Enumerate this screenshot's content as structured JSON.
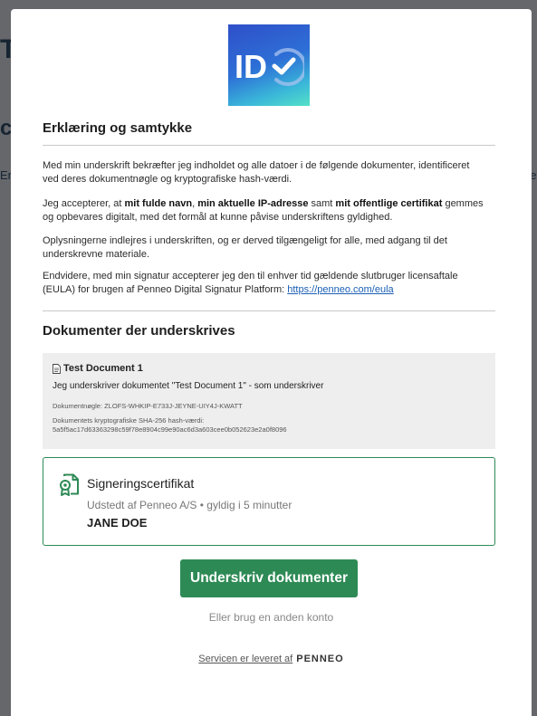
{
  "background": {
    "fragments": [
      "T",
      "c",
      "Er",
      "ne"
    ]
  },
  "modal": {
    "logo_label": "ID",
    "consent": {
      "title": "Erklæring og samtykke",
      "p1": "Med min underskrift bekræfter jeg indholdet og alle datoer i de følgende dokumenter, identificeret ved deres dokumentnøgle og kryptografiske hash-værdi.",
      "p2_a": "Jeg accepterer, at ",
      "p2_b1": "mit fulde navn",
      "p2_c": ", ",
      "p2_b2": "min aktuelle IP-adresse",
      "p2_d": " samt ",
      "p2_b3": "mit offentlige certifikat",
      "p2_e": " gemmes og opbevares digitalt, med det formål at kunne påvise underskriftens gyldighed.",
      "p3": "Oplysningerne indlejres i underskriften, og er derved tilgængeligt for alle, med adgang til det underskrevne materiale.",
      "p4": "Endvidere, med min signatur accepterer jeg den til enhver tid gældende slutbruger licensaftale (EULA) for brugen af Penneo Digital Signatur Platform: ",
      "eula_link": "https://penneo.com/eula"
    },
    "documents": {
      "title": "Dokumenter der underskrives",
      "items": [
        {
          "name": "Test Document 1",
          "description": "Jeg underskriver dokumentet \"Test Document 1\" - som underskriver",
          "key_line": "Dokumentnøgle: ZLOFS-WHKIP-E733J-JEYNE-UIY4J-KWATT",
          "hash_label": "Dokumentets kryptografiske SHA-256 hash-værdi:",
          "hash_value": "5a5f5ac17d63363298c59f78e8904c99e90ac6d3a603cee0b052623e2a0f8096"
        }
      ]
    },
    "certificate": {
      "title": "Signeringscertifikat",
      "issued": "Udstedt af Penneo A/S • gyldig i 5 minutter",
      "name": "JANE DOE"
    },
    "sign_button": "Underskriv dokumenter",
    "alt_account": "Eller brug en anden konto",
    "footer": {
      "text": "Servicen er leveret af",
      "brand": "PENNEO"
    }
  },
  "colors": {
    "accent_green": "#2e8a55",
    "link_blue": "#1a5fb4",
    "logo_gradient": [
      "#2f4fc9",
      "#53e1c7"
    ]
  },
  "icons": [
    "id-check-icon",
    "document-icon",
    "certificate-icon"
  ]
}
